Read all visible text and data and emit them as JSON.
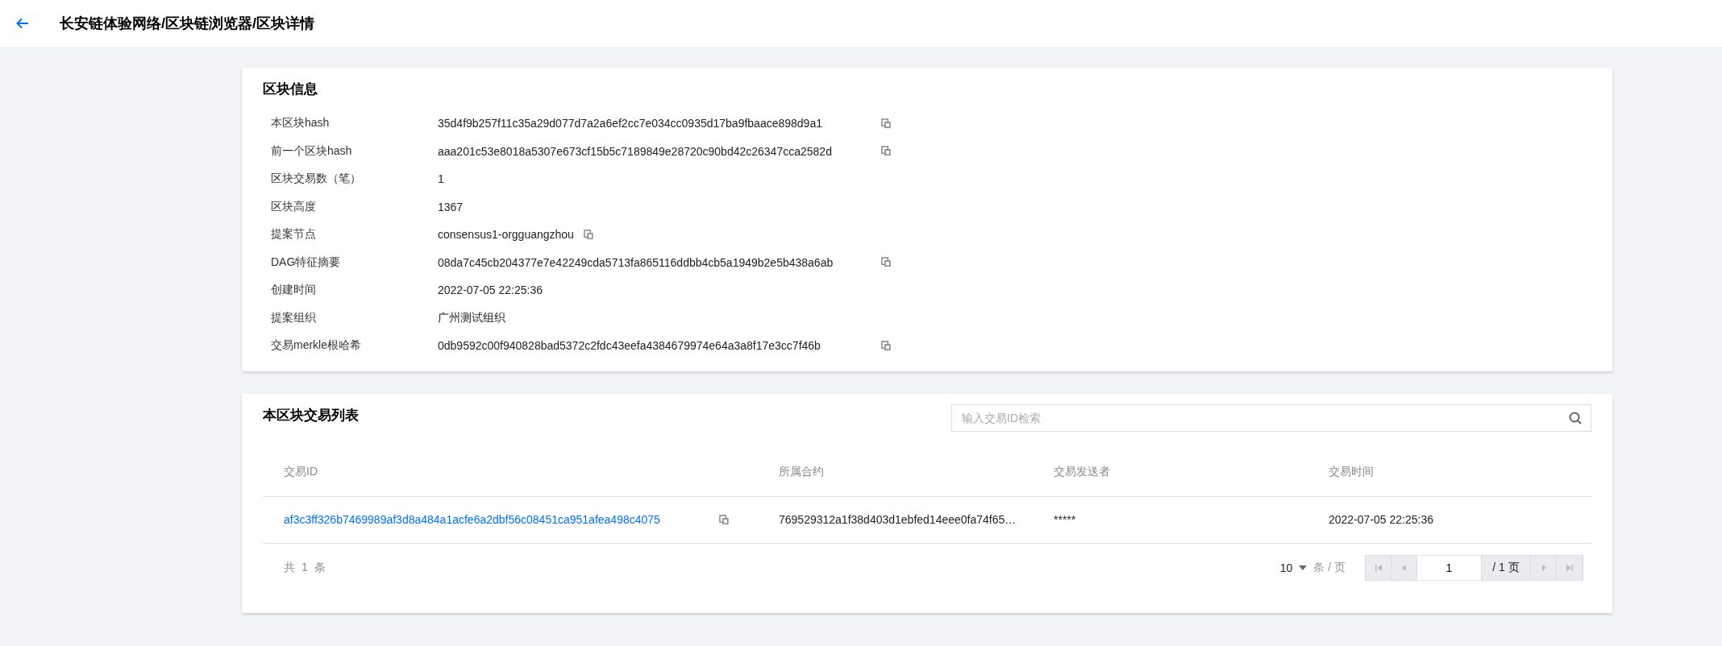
{
  "header": {
    "title": "长安链体验网络/区块链浏览器/区块详情"
  },
  "block_info": {
    "title": "区块信息",
    "fields": [
      {
        "label": "本区块hash",
        "value": "35d4f9b257f11c35a29d077d7a2a6ef2cc7e034cc0935d17ba9fbaace898d9a1",
        "copyable": true
      },
      {
        "label": "前一个区块hash",
        "value": "aaa201c53e8018a5307e673cf15b5c7189849e28720c90bd42c26347cca2582d",
        "copyable": true
      },
      {
        "label": "区块交易数（笔）",
        "value": "1",
        "copyable": false
      },
      {
        "label": "区块高度",
        "value": "1367",
        "copyable": false
      },
      {
        "label": "提案节点",
        "value": "consensus1-orgguangzhou",
        "copyable": true
      },
      {
        "label": "DAG特征摘要",
        "value": "08da7c45cb204377e7e42249cda5713fa865116ddbb4cb5a1949b2e5b438a6ab",
        "copyable": true
      },
      {
        "label": "创建时间",
        "value": "2022-07-05 22:25:36",
        "copyable": false
      },
      {
        "label": "提案组织",
        "value": "广州测试组织",
        "copyable": false
      },
      {
        "label": "交易merkle根哈希",
        "value": "0db9592c00f940828bad5372c2fdc43eefa4384679974e64a3a8f17e3cc7f46b",
        "copyable": true
      }
    ]
  },
  "transactions": {
    "title": "本区块交易列表",
    "search": {
      "placeholder": "输入交易ID检索"
    },
    "columns": [
      "交易ID",
      "所属合约",
      "交易发送者",
      "交易时间"
    ],
    "rows": [
      {
        "id": "af3c3ff326b7469989af3d8a484a1acfe6a2dbf56c08451ca951afea498c4075",
        "contract": "769529312a1f38d403d1ebfed14eee0fa74f65…",
        "sender": "*****",
        "time": "2022-07-05 22:25:36"
      }
    ],
    "total": {
      "prefix": "共",
      "count": "1",
      "suffix": "条"
    },
    "pagination": {
      "page_size": "10",
      "page_size_unit": "条 / 页",
      "page": "1",
      "page_total": "/ 1 页"
    }
  }
}
